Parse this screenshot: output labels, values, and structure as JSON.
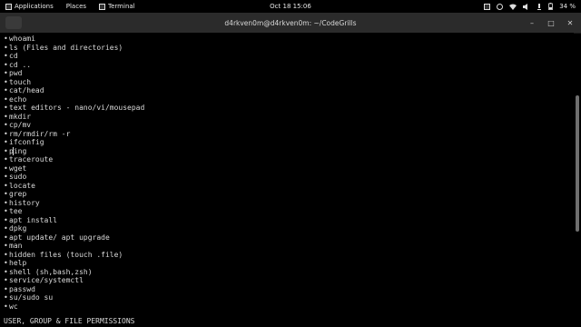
{
  "topbar": {
    "applications": "Applications",
    "places": "Places",
    "terminal": "Terminal",
    "datetime": "Oct 18  15:06",
    "battery": "34 %"
  },
  "titlebar": {
    "title": "d4rkven0m@d4rkven0m: ~/CodeGrills",
    "min": "–",
    "max": "□",
    "close": "✕"
  },
  "terminal": {
    "lines": [
      "whoami",
      "ls (Files and directories)",
      "cd",
      "cd ..",
      "pwd",
      "touch",
      "cat/head",
      "echo",
      "text editors - nano/vi/mousepad",
      "mkdir",
      "cp/mv",
      "rm/rmdir/rm -r",
      "ifconfig",
      "ping",
      "traceroute",
      "wget",
      "sudo",
      "locate",
      "grep",
      "history",
      "tee",
      "apt install",
      "dpkg",
      "apt update/ apt upgrade",
      "man",
      "hidden files (touch .file)",
      "help",
      "shell (sh,bash,zsh)",
      "service/systemctl",
      "passwd",
      "su/sudo su",
      "wc"
    ],
    "footer": "USER, GROUP & FILE PERMISSIONS"
  },
  "icons": {
    "terminal_app": "terminal-icon",
    "topbar_right": [
      "display-icon",
      "network-icon",
      "wifi-icon",
      "volume-icon",
      "microphone-icon",
      "battery-icon"
    ]
  }
}
